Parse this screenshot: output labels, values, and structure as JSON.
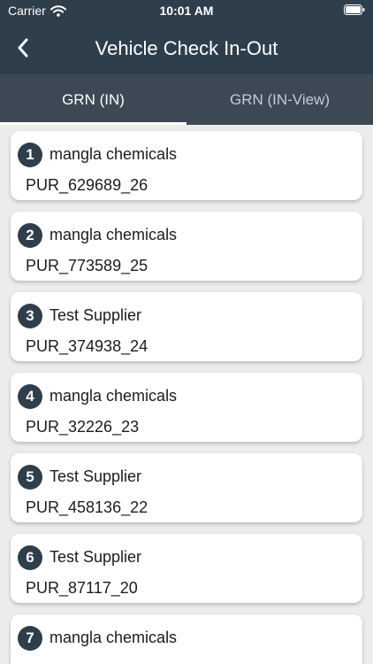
{
  "status_bar": {
    "carrier": "Carrier",
    "time": "10:01 AM",
    "icons": [
      "wifi-icon",
      "battery-icon"
    ]
  },
  "header": {
    "title": "Vehicle Check In-Out",
    "back_icon": "chevron-left-icon"
  },
  "tabs": [
    {
      "label": "GRN (IN)",
      "active": true
    },
    {
      "label": "GRN (IN-View)",
      "active": false
    }
  ],
  "records": [
    {
      "index": "1",
      "supplier": "mangla chemicals",
      "po": "PUR_629689_26"
    },
    {
      "index": "2",
      "supplier": "mangla chemicals",
      "po": "PUR_773589_25"
    },
    {
      "index": "3",
      "supplier": "Test Supplier",
      "po": "PUR_374938_24"
    },
    {
      "index": "4",
      "supplier": "mangla chemicals",
      "po": "PUR_32226_23"
    },
    {
      "index": "5",
      "supplier": "Test Supplier",
      "po": "PUR_458136_22"
    },
    {
      "index": "6",
      "supplier": "Test Supplier",
      "po": "PUR_87117_20"
    },
    {
      "index": "7",
      "supplier": "mangla chemicals",
      "po": ""
    }
  ],
  "colors": {
    "header_bg": "#2f3e4b",
    "tab_bar_bg": "#3c4955",
    "page_bg": "#ececec",
    "card_bg": "#ffffff"
  }
}
